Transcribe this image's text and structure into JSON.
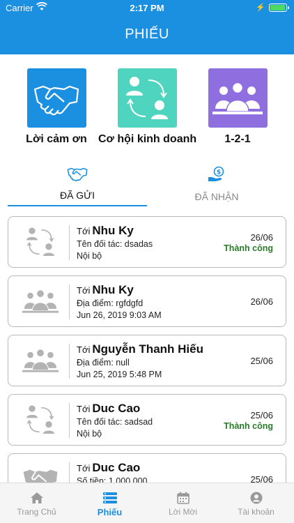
{
  "status_bar": {
    "carrier": "Carrier",
    "time": "2:17 PM"
  },
  "header": {
    "title": "PHIẾU"
  },
  "categories": [
    {
      "label": "Lời cảm ơn",
      "icon": "handshake-icon"
    },
    {
      "label": "Cơ hội kinh doanh",
      "icon": "exchange-people-icon"
    },
    {
      "label": "1-2-1",
      "icon": "group-icon"
    }
  ],
  "tabs": {
    "sent": "ĐÃ GỬI",
    "received": "ĐÃ NHẬN"
  },
  "cards": [
    {
      "to": "Tới",
      "name": "Nhu Ky",
      "line2": "Tên đối tác: dsadas",
      "line3": "Nội bộ",
      "date": "26/06",
      "status": "Thành công",
      "icon": "exchange-people-icon"
    },
    {
      "to": "Tới",
      "name": "Nhu Ky",
      "line2": "Địa điểm: rgfdgfd",
      "line3": "Jun 26, 2019 9:03 AM",
      "date": "26/06",
      "status": "",
      "icon": "group-icon"
    },
    {
      "to": "Tới",
      "name": "Nguyễn Thanh Hiếu",
      "line2": "Địa điểm: null",
      "line3": "Jun 25, 2019 5:48 PM",
      "date": "25/06",
      "status": "",
      "icon": "group-icon"
    },
    {
      "to": "Tới",
      "name": "Duc Cao",
      "line2": "Tên đối tác: sadsad",
      "line3": "Nội bộ",
      "date": "25/06",
      "status": "Thành công",
      "icon": "exchange-people-icon"
    },
    {
      "to": "Tới",
      "name": "Duc Cao",
      "line2": "Số tiền: 1.000.000",
      "line3": "",
      "date": "25/06",
      "status": "",
      "icon": "handshake-icon"
    }
  ],
  "bottom_nav": [
    {
      "label": "Trang Chủ",
      "icon": "home-icon"
    },
    {
      "label": "Phiếu",
      "icon": "list-icon"
    },
    {
      "label": "Lời Mời",
      "icon": "calendar-icon"
    },
    {
      "label": "Tài khoản",
      "icon": "account-icon"
    }
  ],
  "colors": {
    "primary": "#1b8fe0",
    "success": "#2a7a2a",
    "teal": "#4ed4bf",
    "purple": "#8f6ee0"
  }
}
